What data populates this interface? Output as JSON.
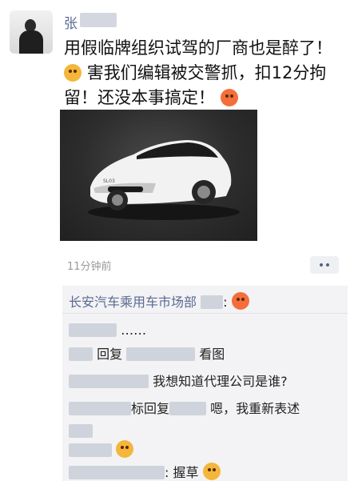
{
  "post": {
    "author": "张",
    "text_line1": "用假临牌组织试驾的厂商也是醉了！",
    "text_line2": "害我们编辑被交警抓，扣12分拘",
    "text_line3": "留！还没本事搞定！",
    "time": "11分钟前"
  },
  "car_image": {
    "badge": "SL03"
  },
  "comments": [
    {
      "user": "长安汽车乘用车市场部",
      "text": ":"
    },
    {
      "user": "",
      "text": "……"
    },
    {
      "user": "",
      "text": "回复",
      "tail": "看图"
    },
    {
      "user": "",
      "text": "我想知道代理公司是谁?"
    },
    {
      "user": "",
      "text": "标回复",
      "tail": "嗯，我重新表述"
    },
    {
      "user": "",
      "text": ""
    },
    {
      "user": "",
      "text": ""
    },
    {
      "user": "",
      "text": ": 握草"
    }
  ]
}
